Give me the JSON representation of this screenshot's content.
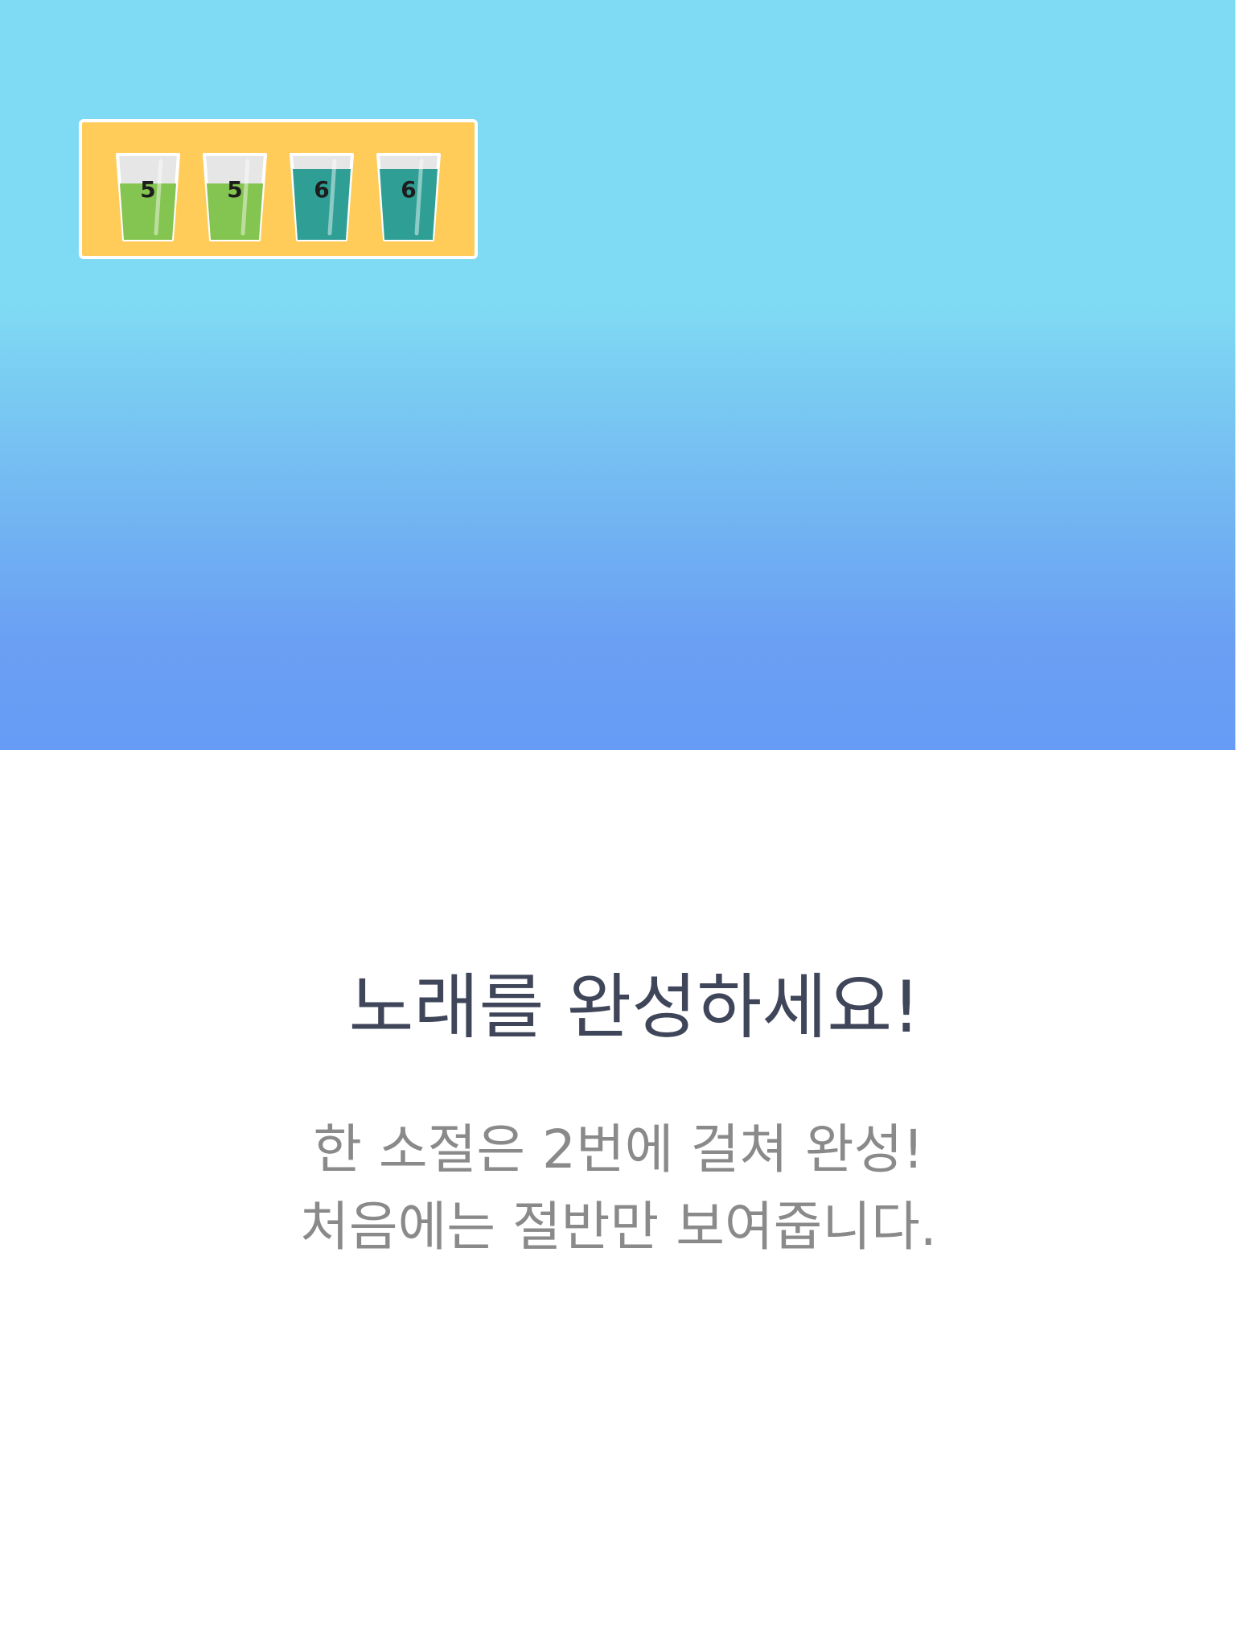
{
  "hero": {
    "cups": [
      {
        "number": "5",
        "color": "#84c450"
      },
      {
        "number": "5",
        "color": "#84c450"
      },
      {
        "number": "6",
        "color": "#2f9f96"
      },
      {
        "number": "6",
        "color": "#2f9f96"
      }
    ]
  },
  "text": {
    "title": "노래를 완성하세요!",
    "line1": "한 소절은 2번에 걸쳐 완성!",
    "line2": "처음에는 절반만 보여줍니다."
  },
  "colors": {
    "panel": "#ffcc5a",
    "sky_top": "#7fdbf3",
    "sky_bottom": "#669cf5"
  }
}
